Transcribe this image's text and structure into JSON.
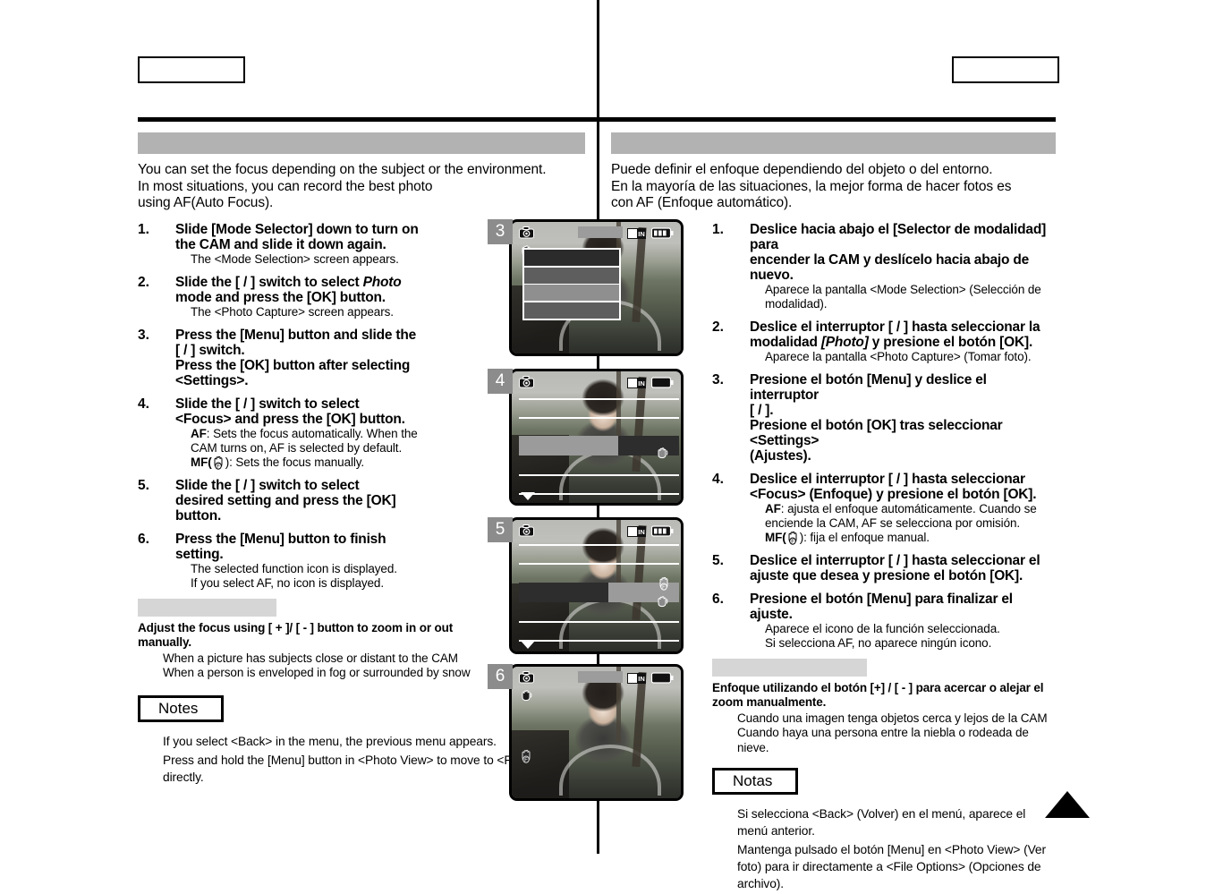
{
  "page": {
    "header_box_left_label": "",
    "header_box_right_label": "",
    "section_bar_left_label": "",
    "section_bar_right_label": "",
    "tip_bar_left_label": "",
    "tip_bar_right_label": ""
  },
  "english": {
    "intro_lines": [
      "You can set the focus depending on the subject or the environment.",
      "In most situations, you can record the best photo",
      "using AF(Auto Focus)."
    ],
    "steps": [
      {
        "num": "1.",
        "title_lines": [
          "Slide [Mode Selector] down to turn on",
          "the CAM and slide it down again."
        ],
        "subs": [
          "The <Mode Selection> screen appears."
        ]
      },
      {
        "num": "2.",
        "title_lead": "Slide the [    /    ] switch to select ",
        "title_italic": "Photo",
        "title_rest": "mode and press the [OK] button.",
        "subs": [
          "The <Photo Capture> screen appears."
        ]
      },
      {
        "num": "3.",
        "title_lines": [
          "Press the [Menu] button and slide the",
          "[    /    ] switch.",
          "Press the [OK] button after selecting",
          "<Settings>."
        ],
        "subs": []
      },
      {
        "num": "4.",
        "title_lines": [
          "Slide the [    /    ] switch to select",
          "<Focus> and press the [OK] button."
        ],
        "sub_af_label": "AF",
        "sub_af_text": ": Sets the focus automatically. When the",
        "sub_af_text2": "CAM turns on, AF is selected by default.",
        "sub_mf_label": "MF(",
        "sub_mf_text": "): Sets the focus manually."
      },
      {
        "num": "5.",
        "title_lines": [
          "Slide the [    /    ] switch to select",
          "desired setting and press the [OK]",
          "button."
        ],
        "subs": []
      },
      {
        "num": "6.",
        "title_lines": [
          "Press the [Menu] button to finish",
          "setting."
        ],
        "subs": [
          "The selected function icon is displayed.",
          "If you select  AF, no icon is displayed."
        ]
      }
    ],
    "tip_title_lines": [
      "Adjust the focus using [ + ]/ [ - ] button to zoom in or out",
      "manually."
    ],
    "tip_items": [
      "When a picture has subjects close or distant to the CAM",
      "When a person is enveloped in fog or surrounded by snow"
    ],
    "notes_label": "Notes",
    "notes": [
      "If you select <Back> in the menu, the previous menu appears.",
      "Press and hold the [Menu] button in <Photo View> to move to <File Options> directly."
    ]
  },
  "spanish": {
    "intro_lines": [
      "Puede definir el enfoque dependiendo del objeto o del entorno.",
      "En la mayoría de las situaciones, la mejor forma de hacer fotos es",
      "con AF (Enfoque automático)."
    ],
    "steps": [
      {
        "num": "1.",
        "title_lines": [
          "Deslice hacia abajo el [Selector de modalidad] para",
          "encender la CAM y deslícelo hacia abajo de nuevo."
        ],
        "subs": [
          "Aparece la pantalla <Mode Selection> (Selección de",
          "modalidad)."
        ]
      },
      {
        "num": "2.",
        "title_lead": "Deslice el interruptor [    /    ] hasta seleccionar la",
        "title_pre": "modalidad ",
        "title_italic": "[Photo]",
        "title_rest": " y presione el botón [OK].",
        "subs": [
          "Aparece la pantalla <Photo Capture> (Tomar foto)."
        ]
      },
      {
        "num": "3.",
        "title_lines": [
          "Presione el botón [Menu] y deslice el interruptor",
          "[    /    ].",
          "Presione el botón [OK] tras seleccionar <Settings>",
          "(Ajustes)."
        ],
        "subs": []
      },
      {
        "num": "4.",
        "title_lines": [
          "Deslice el interruptor [    /    ] hasta seleccionar",
          "<Focus> (Enfoque) y presione el botón [OK]."
        ],
        "sub_af_label": "AF",
        "sub_af_text": ": ajusta el enfoque automáticamente. Cuando se",
        "sub_af_text2": "enciende la CAM, AF se selecciona por omisión.",
        "sub_mf_label": "MF(",
        "sub_mf_text": "): fija el enfoque manual."
      },
      {
        "num": "5.",
        "title_lines": [
          "Deslice el interruptor [    /    ] hasta seleccionar el",
          "ajuste que desea y presione el botón [OK]."
        ],
        "subs": []
      },
      {
        "num": "6.",
        "title_lines": [
          "Presione el botón [Menu] para finalizar el ajuste."
        ],
        "subs": [
          "Aparece el icono de la función seleccionada.",
          "Si selecciona AF, no aparece ningún icono."
        ]
      }
    ],
    "tip_title_lines": [
      "Enfoque utilizando el botón [+] / [ - ] para acercar o alejar el",
      "zoom manualmente."
    ],
    "tip_items": [
      "Cuando una imagen tenga objetos cerca y lejos de la CAM",
      "Cuando haya una persona entre la niebla o rodeada de",
      "nieve."
    ],
    "notes_label": "Notas",
    "notes": [
      "Si selecciona <Back> (Volver) en el menú, aparece el menú anterior.",
      "Mantenga pulsado el botón [Menu] en <Photo View> (Ver foto) para ir directamente a <File Options> (Opciones de archivo)."
    ]
  },
  "screenshots": [
    {
      "badge": "3",
      "caption": ""
    },
    {
      "badge": "4",
      "caption": ""
    },
    {
      "badge": "5",
      "caption": ""
    },
    {
      "badge": "6",
      "caption": ""
    }
  ],
  "colors": {
    "section_bar": "#b2b2b2",
    "tip_bar": "#d6d6d6",
    "badge_bg": "#8c8c8c",
    "badge_text": "#ffffff"
  }
}
